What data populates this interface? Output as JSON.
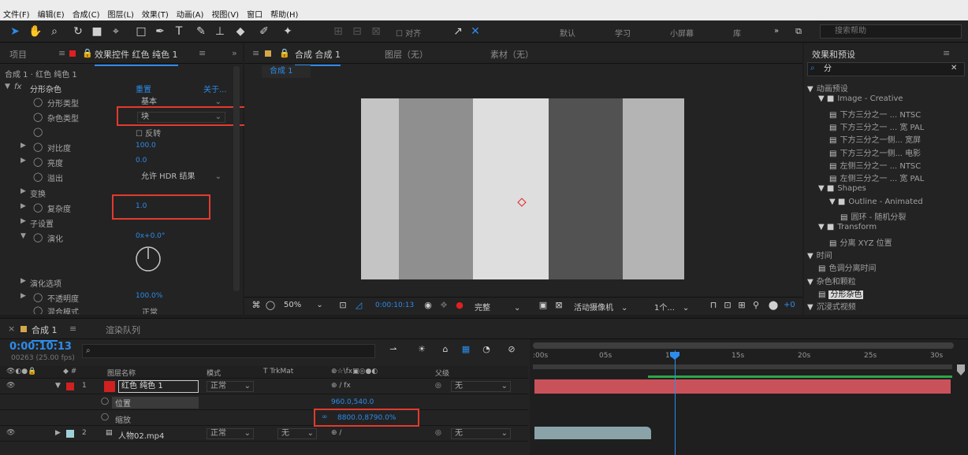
{
  "menu": [
    "文件(F)",
    "编辑(E)",
    "合成(C)",
    "图层(L)",
    "效果(T)",
    "动画(A)",
    "视图(V)",
    "窗口",
    "帮助(H)"
  ],
  "toolbar": {
    "align_label": "对齐",
    "workspaces": [
      "默认",
      "学习",
      "小屏幕",
      "库"
    ],
    "search_placeholder": "搜索帮助"
  },
  "effect_controls": {
    "tab_project": "项目",
    "tab_label": "效果控件 红色 纯色 1",
    "breadcrumb": "合成 1 · 红色 纯色 1",
    "effect_name": "分形杂色",
    "reset_label": "重置",
    "about_label": "关于...",
    "rows": {
      "fractal_type_label": "分形类型",
      "fractal_type_value": "基本",
      "noise_type_label": "杂色类型",
      "noise_type_value": "块",
      "invert_label": "反转",
      "contrast_label": "对比度",
      "contrast_value": "100.0",
      "brightness_label": "亮度",
      "brightness_value": "0.0",
      "overflow_label": "溢出",
      "overflow_value": "允许 HDR 结果",
      "transform_label": "变换",
      "complexity_label": "复杂度",
      "complexity_value": "1.0",
      "sub_settings_label": "子设置",
      "evolution_label": "演化",
      "evolution_value": "0x+0.0°",
      "evolution_options_label": "演化选项",
      "opacity_label": "不透明度",
      "opacity_value": "100.0%",
      "blend_mode_label": "混合模式",
      "blend_mode_value": "正常"
    }
  },
  "composition": {
    "tab_label": "合成 合成 1",
    "tab_layer": "图层（无）",
    "tab_footage": "素材（无）",
    "comp_chip": "合成 1",
    "canvas_colors": [
      "#c4c4c4",
      "#8f8f8f",
      "#dedede",
      "#525252",
      "#b4b4b4"
    ],
    "zoom": "50%",
    "timecode": "0:00:10:13",
    "quality": "完整",
    "camera": "活动摄像机",
    "views": "1个..."
  },
  "effects_presets": {
    "title": "效果和预设",
    "search_value": "分",
    "tree": [
      {
        "label": "动画预设",
        "level": 0,
        "type": "group"
      },
      {
        "label": "Image - Creative",
        "level": 1,
        "type": "folder"
      },
      {
        "label": "下方三分之一 ... NTSC",
        "level": 2,
        "type": "item"
      },
      {
        "label": "下方三分之一 ... 宽 PAL",
        "level": 2,
        "type": "item"
      },
      {
        "label": "下方三分之一侧... 宽屏",
        "level": 2,
        "type": "item"
      },
      {
        "label": "下方三分之一侧... 电影",
        "level": 2,
        "type": "item"
      },
      {
        "label": "左侧三分之一 ... NTSC",
        "level": 2,
        "type": "item"
      },
      {
        "label": "左侧三分之一 ... 宽 PAL",
        "level": 2,
        "type": "item"
      },
      {
        "label": "Shapes",
        "level": 1,
        "type": "folder"
      },
      {
        "label": "Outline - Animated",
        "level": 2,
        "type": "folder"
      },
      {
        "label": "圆环 - 随机分裂",
        "level": 3,
        "type": "item"
      },
      {
        "label": "Transform",
        "level": 1,
        "type": "folder"
      },
      {
        "label": "分离 XYZ 位置",
        "level": 2,
        "type": "item"
      },
      {
        "label": "时间",
        "level": 0,
        "type": "group"
      },
      {
        "label": "色调分离时间",
        "level": 1,
        "type": "item"
      },
      {
        "label": "杂色和颗粒",
        "level": 0,
        "type": "group"
      },
      {
        "label": "分形杂色",
        "level": 1,
        "type": "item"
      },
      {
        "label": "沉浸式视频",
        "level": 0,
        "type": "group"
      }
    ]
  },
  "timeline": {
    "tab_label": "合成 1",
    "render_queue": "渲染队列",
    "timecode": "0:00:10:13",
    "fps_info": "00263 (25.00 fps)",
    "col_layer_name": "图层名称",
    "col_mode": "模式",
    "col_trkmat": "T TrkMat",
    "col_parent": "父级",
    "ruler_labels": [
      ":00s",
      "05s",
      "10s",
      "15s",
      "20s",
      "25s",
      "30s"
    ],
    "layers": [
      {
        "index": "1",
        "name": "红色 纯色 1",
        "color": "#d02020",
        "mode": "正常",
        "parent": "无"
      },
      {
        "index": "2",
        "name": "人物02.mp4",
        "color": "#9fd0d8",
        "mode": "正常",
        "parent": "无",
        "trkmat": "无"
      }
    ],
    "sub_props": {
      "position_label": "位置",
      "scale_label": "缩放",
      "scale_value": "8800.0,8790.0%",
      "position_value": "960.0,540.0"
    }
  }
}
